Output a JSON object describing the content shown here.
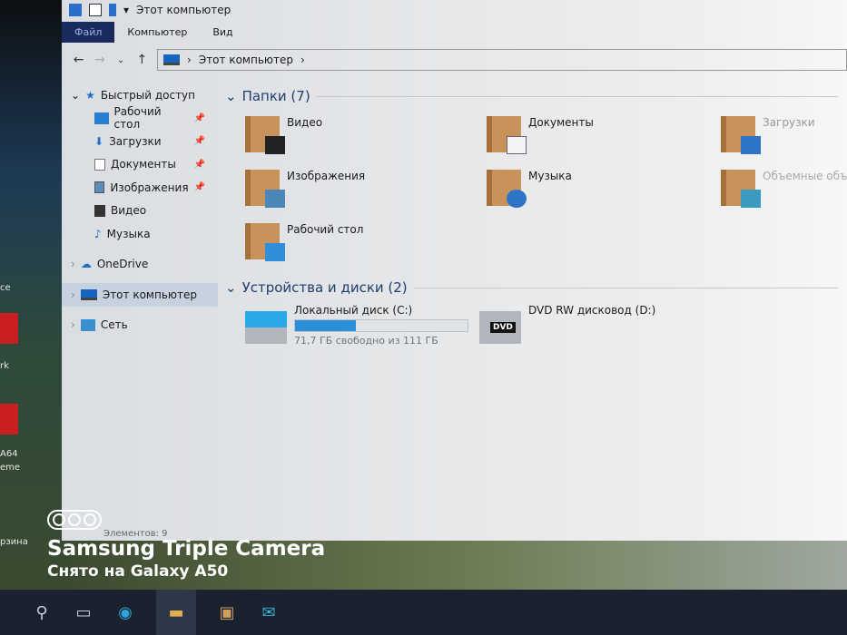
{
  "desktop": {
    "labels": [
      "ce",
      "rk",
      "A64",
      "eme",
      "рзина"
    ]
  },
  "window": {
    "title": "Этот компьютер",
    "ribbon_tabs": [
      "Файл",
      "Компьютер",
      "Вид"
    ],
    "address": {
      "path": "Этот компьютер"
    },
    "sidebar": [
      {
        "label": "Быстрый доступ",
        "pinned": false
      },
      {
        "label": "Рабочий стол",
        "pinned": true
      },
      {
        "label": "Загрузки",
        "pinned": true
      },
      {
        "label": "Документы",
        "pinned": true
      },
      {
        "label": "Изображения",
        "pinned": true
      },
      {
        "label": "Видео",
        "pinned": false
      },
      {
        "label": "Музыка",
        "pinned": false
      },
      {
        "label": "OneDrive",
        "pinned": false
      },
      {
        "label": "Этот компьютер",
        "pinned": false
      },
      {
        "label": "Сеть",
        "pinned": false
      }
    ],
    "folders_header": "Папки (7)",
    "folders": [
      "Видео",
      "Документы",
      "Загрузки",
      "Изображения",
      "Музыка",
      "Объемные объекты",
      "Рабочий стол"
    ],
    "devices_header": "Устройства и диски (2)",
    "drives": [
      {
        "name": "Локальный диск (C:)",
        "free_text": "71,7 ГБ свободно из 111 ГБ",
        "used_percent": 35
      },
      {
        "name": "DVD RW дисковод (D:)",
        "badge": "DVD"
      }
    ],
    "status": "Элементов: 9"
  },
  "watermark": {
    "title": "Samsung Triple Camera",
    "subtitle": "Снято на Galaxy A50"
  },
  "colors": {
    "accent": "#2a8fd8",
    "ribbon_file": "#1b2a5c"
  }
}
